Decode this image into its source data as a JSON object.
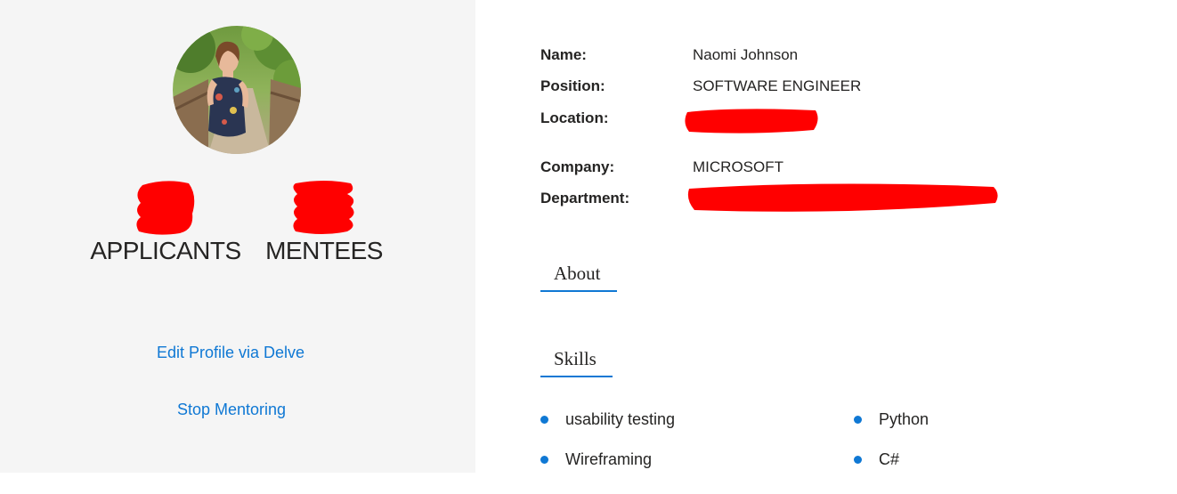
{
  "profile": {
    "avatar_alt": "profile photo"
  },
  "stats": {
    "applicants_label": "APPLICANTS",
    "mentees_label": "MENTEES"
  },
  "links": {
    "edit_profile": "Edit Profile via Delve",
    "stop_mentoring": "Stop Mentoring"
  },
  "info": {
    "name_label": "Name:",
    "name_value": "Naomi Johnson",
    "position_label": "Position:",
    "position_value": "SOFTWARE ENGINEER",
    "location_label": "Location:",
    "company_label": "Company:",
    "company_value": "MICROSOFT",
    "department_label": "Department:"
  },
  "sections": {
    "about": "About",
    "skills": "Skills"
  },
  "skills": [
    "usability testing",
    "Python",
    "Wireframing",
    "C#"
  ],
  "colors": {
    "accent": "#0f78d4",
    "panel_bg": "#f5f5f5",
    "redaction": "#ff0000"
  }
}
